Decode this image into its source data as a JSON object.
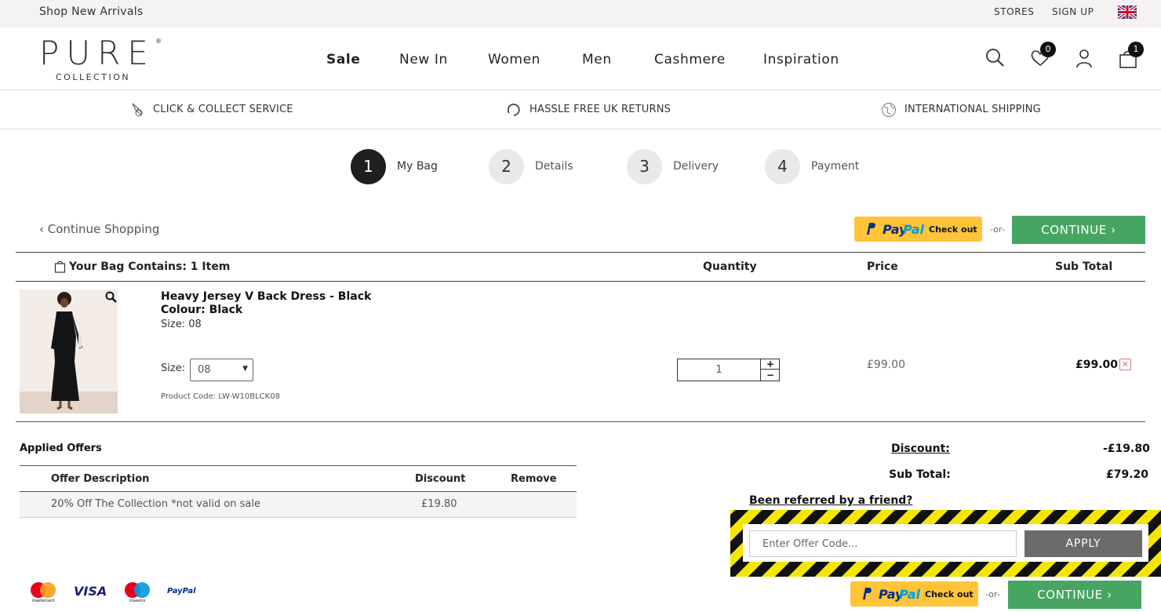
{
  "topbar": {
    "promo": "Shop New Arrivals",
    "stores": "STORES",
    "signup": "SIGN UP",
    "flag_icon": "uk-flag-icon"
  },
  "brand": {
    "name": "PURE",
    "sub": "COLLECTION",
    "reg": "®"
  },
  "nav": [
    "Sale",
    "New In",
    "Women",
    "Men",
    "Cashmere",
    "Inspiration"
  ],
  "header_icons": {
    "search": "search-icon",
    "wishlist": "heart-icon",
    "wishlist_count": "0",
    "account": "user-icon",
    "bag": "bag-icon",
    "bag_count": "1"
  },
  "services": [
    "CLICK & COLLECT SERVICE",
    "HASSLE FREE UK RETURNS",
    "INTERNATIONAL SHIPPING"
  ],
  "steps": [
    {
      "num": "1",
      "label": "My Bag",
      "active": true
    },
    {
      "num": "2",
      "label": "Details"
    },
    {
      "num": "3",
      "label": "Delivery"
    },
    {
      "num": "4",
      "label": "Payment"
    }
  ],
  "actions": {
    "continue_shopping": "‹ Continue Shopping",
    "or": "-or-",
    "continue": "CONTINUE ›",
    "paypal_pay": "Pay",
    "paypal_pal": "Pal",
    "paypal_checkout": "Check out"
  },
  "bag": {
    "heading": "Your Bag Contains: 1 Item",
    "col_quantity": "Quantity",
    "col_price": "Price",
    "col_subtotal": "Sub Total",
    "item": {
      "name": "Heavy Jersey V Back Dress - Black",
      "colour": "Colour: Black",
      "size_text": "Size: 08",
      "size_label": "Size:",
      "size_selected": "08",
      "code": "Product Code: LW-W10BLCK08",
      "qty": "1",
      "price": "£99.00",
      "subtotal": "£99.00"
    }
  },
  "offers": {
    "title": "Applied Offers",
    "col_desc": "Offer Description",
    "col_discount": "Discount",
    "col_remove": "Remove",
    "rows": [
      {
        "desc": "20% Off The Collection *not valid on sale",
        "discount": "£19.80"
      }
    ]
  },
  "totals": {
    "discount_label": "Discount:",
    "discount_value": "-£19.80",
    "subtotal_label": "Sub Total:",
    "subtotal_value": "£79.20"
  },
  "referral": {
    "text": "Been referred by a friend?",
    "placeholder": "Enter Offer Code...",
    "apply": "APPLY"
  },
  "payment_logos": {
    "mastercard": "mastercard",
    "visa": "VISA",
    "maestro": "maestro",
    "paypal": "PayPal"
  },
  "colors": {
    "continue_green": "#47a563",
    "paypal_yellow": "#ffc439",
    "hazard_yellow": "#f4e600"
  }
}
